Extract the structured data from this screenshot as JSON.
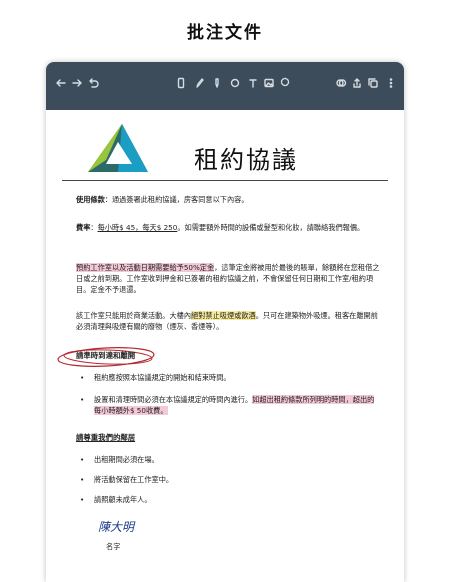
{
  "promo": {
    "title": "批注文件"
  },
  "doc": {
    "title": "租約協議",
    "usage_label": "使用條款",
    "usage_text": "：通過簽署此租約協議，房客同意以下內容。",
    "fee_label": "費率",
    "fee_text_1": "：",
    "fee_underlined": "每小時$ 45，每天$ 250",
    "fee_text_2": "。如需要額外時間的設備或髮型和化妝，請聯絡我們報價。",
    "deposit_hl": "預約工作室以及活動日期需要給予50%定金",
    "deposit_text": "，這筆定金將被用於最後的賬單，餘額將在您租借之日或之前到期。工作室收到押金和已簽署的租約協議之前，不會保留任何日期和工作室/租約項目。定金不予退還。",
    "usage2_text_1": "該工作室只能用於商業活動。大樓內",
    "usage2_hl": "絕對禁止吸煙或飲酒",
    "usage2_text_2": "。只可在建築物外吸煙。租客在離開前必須清理與吸煙有關的廢物（煙灰、香煙等）。",
    "section1": "請準時到達和離開",
    "s1_bullets": [
      {
        "text": "租約應按照本協議規定的開始和結束時間。"
      },
      {
        "text_1": "設置和清理時間必須在本協議規定的時間內進行。",
        "hl": "如超出租約條款所列明的時間，超出的每小時額外$ 50收費。"
      }
    ],
    "section2": "請尊重我們的鄰居",
    "s2_bullets": [
      "出租期間必須在場。",
      "將活動保留在工作室中。",
      "請照顧未成年人。"
    ],
    "signature": "陳大明",
    "signature_label": "名字"
  },
  "toolbar": {
    "icons": [
      "back-arrow-icon",
      "forward-arrow-icon",
      "undo-icon",
      "phone-icon",
      "pen-icon",
      "marker-icon",
      "eraser-icon",
      "text-icon",
      "image-icon",
      "lasso-icon",
      "layers-icon",
      "share-icon",
      "copy-icon",
      "more-icon"
    ]
  },
  "colors": {
    "toolbar": "#3c4c5a",
    "pink_highlight": "#f4c9d6",
    "yellow_highlight": "#f7ec9c",
    "circle_ink": "#b3262e"
  }
}
